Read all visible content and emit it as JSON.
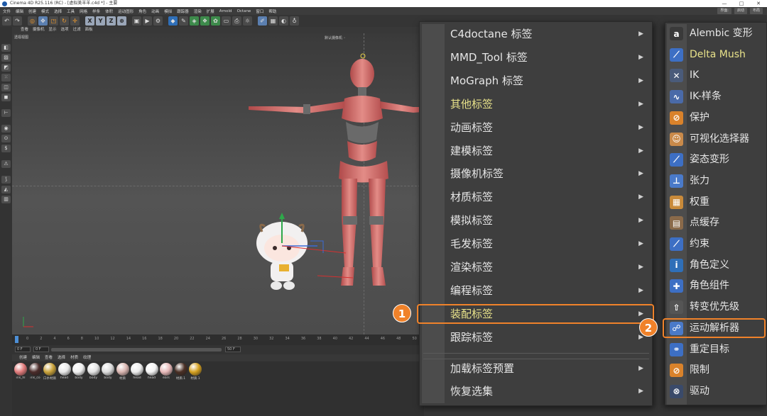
{
  "window": {
    "title": "Cinema 4D R25.116 (RC) - [虚拟美羊羊.c4d *] - 主要",
    "controls": [
      "—",
      "□",
      "✕"
    ]
  },
  "menubar": {
    "items": [
      "文件",
      "编辑",
      "创建",
      "模式",
      "选择",
      "工具",
      "网格",
      "样条",
      "体积",
      "运动图形",
      "角色",
      "动画",
      "模拟",
      "跟踪器",
      "渲染",
      "扩展",
      "Arnold",
      "Octane",
      "窗口",
      "帮助"
    ],
    "layout_label": "界面:",
    "layout_value": "启动",
    "layout_btn": "布局"
  },
  "viewport": {
    "menu": [
      "查看",
      "摄像机",
      "显示",
      "选项",
      "过滤",
      "面板"
    ],
    "label": "透视视图",
    "camera_label": "默认摄像机 ◦"
  },
  "timeline": {
    "ticks": [
      "0",
      "2",
      "4",
      "6",
      "8",
      "10",
      "12",
      "14",
      "16",
      "18",
      "20",
      "22",
      "24",
      "26",
      "28",
      "30",
      "32",
      "34",
      "36",
      "38",
      "40",
      "42",
      "44",
      "46",
      "48",
      "50"
    ],
    "current_frame": "0 F",
    "start_frame": "0 F",
    "end_frame": "50 F"
  },
  "materials": {
    "menu": [
      "创建",
      "编辑",
      "查看",
      "选择",
      "材质",
      "纹理"
    ],
    "items": [
      {
        "name": "iris_hl",
        "color": "#e07a7a"
      },
      {
        "name": "iris_co",
        "color": "#4a2c2a"
      },
      {
        "name": "口水材质",
        "color": "#c9a23a"
      },
      {
        "name": "head",
        "color": "#e8e8e8"
      },
      {
        "name": "body",
        "color": "#f0f0f0"
      },
      {
        "name": "body",
        "color": "#e4e4e4"
      },
      {
        "name": "body",
        "color": "#dcdcdc"
      },
      {
        "name": "材质",
        "color": "#d9b5b0"
      },
      {
        "name": "head",
        "color": "#ececec"
      },
      {
        "name": "head",
        "color": "#f3f3f3"
      },
      {
        "name": "ears",
        "color": "#e6b8b8"
      },
      {
        "name": "材质.1",
        "color": "#4a3026"
      },
      {
        "name": "材质.1",
        "color": "#d4a020"
      }
    ]
  },
  "submenu_tags": {
    "items": [
      {
        "label": "C4doctane 标签",
        "highlight": false
      },
      {
        "label": "MMD_Tool 标签",
        "highlight": false
      },
      {
        "label": "MoGraph 标签",
        "highlight": false
      },
      {
        "label": "其他标签",
        "highlight": true
      },
      {
        "label": "动画标签",
        "highlight": false
      },
      {
        "label": "建模标签",
        "highlight": false
      },
      {
        "label": "摄像机标签",
        "highlight": false
      },
      {
        "label": "材质标签",
        "highlight": false
      },
      {
        "label": "模拟标签",
        "highlight": false
      },
      {
        "label": "毛发标签",
        "highlight": false
      },
      {
        "label": "渲染标签",
        "highlight": false
      },
      {
        "label": "编程标签",
        "highlight": false
      },
      {
        "label": "装配标签",
        "highlight": true
      },
      {
        "label": "跟踪标签",
        "highlight": false
      }
    ],
    "extra_items": [
      "加载标签预置",
      "恢复选集"
    ],
    "arrow": "▶"
  },
  "submenu_rigging": {
    "items": [
      {
        "label": "Alembic 变形",
        "icon": "alembic-icon",
        "glyph": "a",
        "color": "#3a3a3a"
      },
      {
        "label": "Delta Mush",
        "icon": "delta-mush-icon",
        "glyph": "⟋",
        "color": "#3d6fc4",
        "highlight": true
      },
      {
        "label": "IK",
        "icon": "ik-icon",
        "glyph": "✕",
        "color": "#4a5b7a"
      },
      {
        "label": "IK-样条",
        "icon": "ik-spline-icon",
        "glyph": "∿",
        "color": "#4a6aa8"
      },
      {
        "label": "保护",
        "icon": "protection-icon",
        "glyph": "⊘",
        "color": "#d9822b"
      },
      {
        "label": "可视化选择器",
        "icon": "visual-selector-icon",
        "glyph": "☺",
        "color": "#c98a4a"
      },
      {
        "label": "姿态变形",
        "icon": "pose-morph-icon",
        "glyph": "⟋",
        "color": "#3d6fc4"
      },
      {
        "label": "张力",
        "icon": "tension-icon",
        "glyph": "⊥",
        "color": "#4a7ac9"
      },
      {
        "label": "权重",
        "icon": "weight-icon",
        "glyph": "▦",
        "color": "#c98a3a"
      },
      {
        "label": "点缓存",
        "icon": "point-cache-icon",
        "glyph": "▤",
        "color": "#8a6a4a"
      },
      {
        "label": "约束",
        "icon": "constraint-icon",
        "glyph": "⟋",
        "color": "#3d6fc4"
      },
      {
        "label": "角色定义",
        "icon": "character-definition-icon",
        "glyph": "i",
        "color": "#2f6fb8"
      },
      {
        "label": "角色组件",
        "icon": "character-component-icon",
        "glyph": "✚",
        "color": "#3d6fc4"
      },
      {
        "label": "转变优先级",
        "icon": "priority-icon",
        "glyph": "⇧",
        "color": "#555555"
      },
      {
        "label": "运动解析器",
        "icon": "motion-solver-icon",
        "glyph": "☍",
        "color": "#4a7ac9"
      },
      {
        "label": "重定目标",
        "icon": "retarget-icon",
        "glyph": "⚭",
        "color": "#3d6fc4"
      },
      {
        "label": "限制",
        "icon": "clamp-icon",
        "glyph": "⊘",
        "color": "#d9822b"
      },
      {
        "label": "驱动",
        "icon": "driver-icon",
        "glyph": "⊗",
        "color": "#3a4a6a"
      }
    ]
  },
  "callouts": {
    "step1": "1",
    "step2": "2",
    "accent": "#f0822a"
  }
}
